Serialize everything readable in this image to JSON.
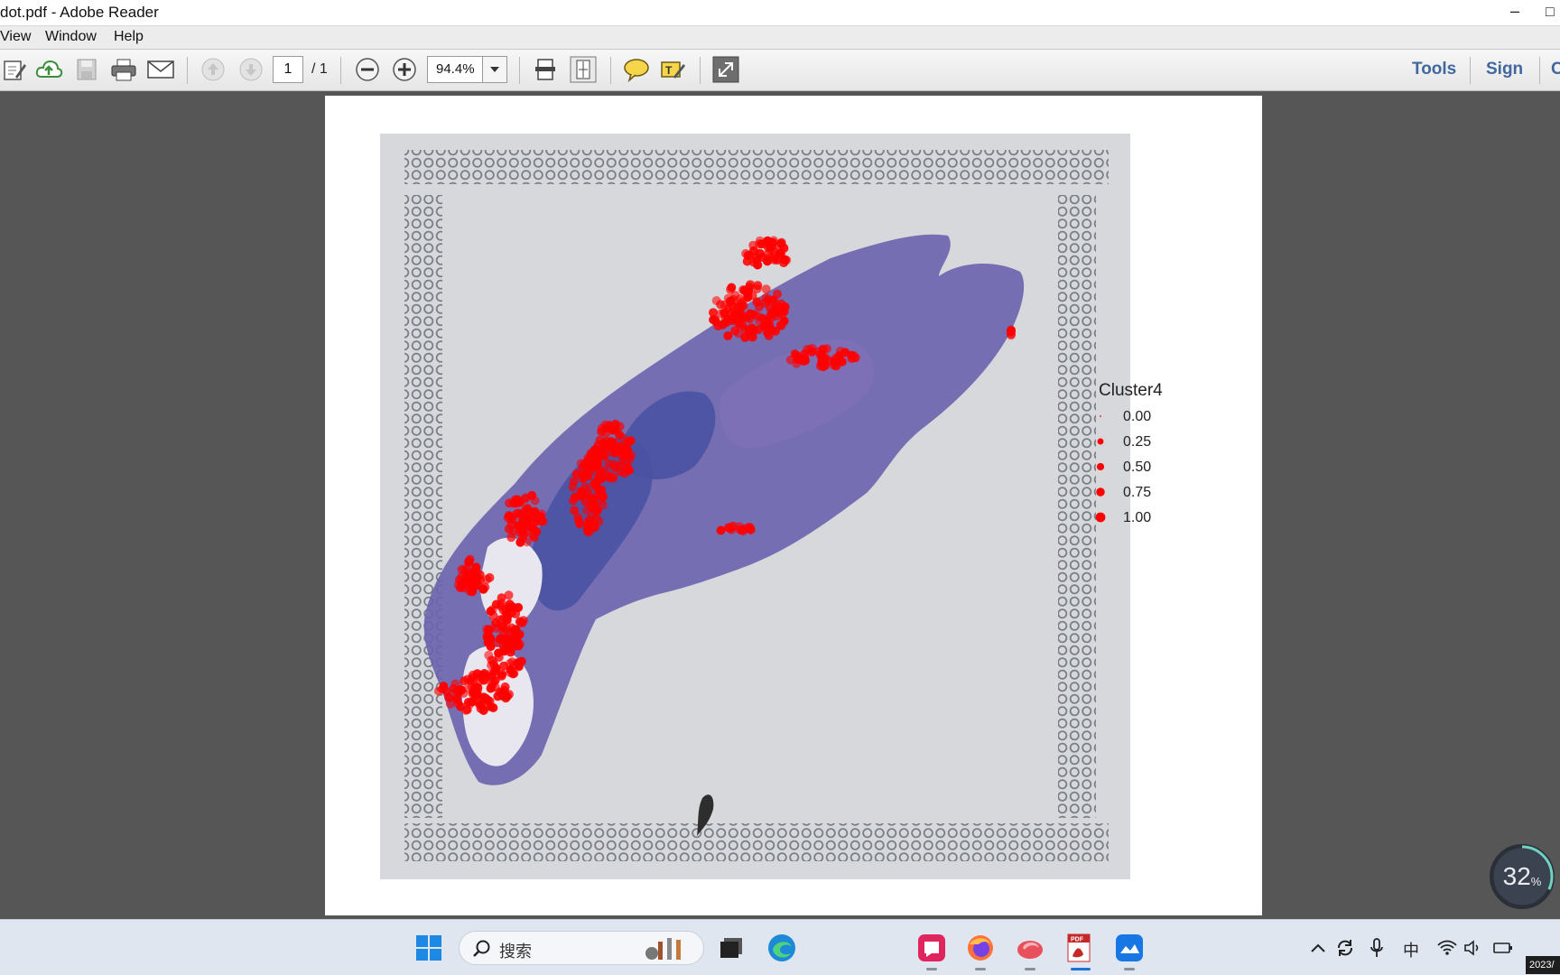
{
  "window": {
    "title": "dot.pdf - Adobe Reader",
    "minimize_glyph": "–",
    "maximize_glyph": "□"
  },
  "menu": [
    {
      "label": "View"
    },
    {
      "label": "Window"
    },
    {
      "label": "Help"
    }
  ],
  "toolbar": {
    "page_current": "1",
    "page_total": "/ 1",
    "zoom": "94.4%",
    "tools_label": "Tools",
    "sign_label": "Sign",
    "comment_label": "C"
  },
  "icons": {
    "edit": "edit-icon",
    "upload": "cloud-upload-icon",
    "save": "save-icon",
    "print": "print-icon",
    "email": "email-icon",
    "prev_page": "arrow-up-icon",
    "next_page": "arrow-down-icon",
    "zoom_out": "zoom-out-icon",
    "zoom_in": "zoom-in-icon",
    "fit_width": "fit-width-icon",
    "fit_page": "fit-page-icon",
    "comment": "comment-icon",
    "highlight": "highlight-icon",
    "fullscreen": "fullscreen-icon"
  },
  "document": {
    "legend_title": "Cluster4",
    "legend_items": [
      {
        "label": "0.00",
        "value": 0.0
      },
      {
        "label": "0.25",
        "value": 0.25
      },
      {
        "label": "0.50",
        "value": 0.5
      },
      {
        "label": "0.75",
        "value": 0.75
      },
      {
        "label": "1.00",
        "value": 1.0
      }
    ],
    "point_color": "#ff0000",
    "tissue_color": "#6c63ad",
    "background_color": "#d6d8dc"
  },
  "overlay": {
    "progress_value": "32",
    "progress_unit": "%",
    "progress_fraction": 0.32
  },
  "taskbar": {
    "search_placeholder": "搜索",
    "ime_label": "中",
    "clock_fragment": "2023/"
  },
  "colors": {
    "accent_link": "#40689e",
    "taskbar_bg": "#dfe6f0"
  }
}
